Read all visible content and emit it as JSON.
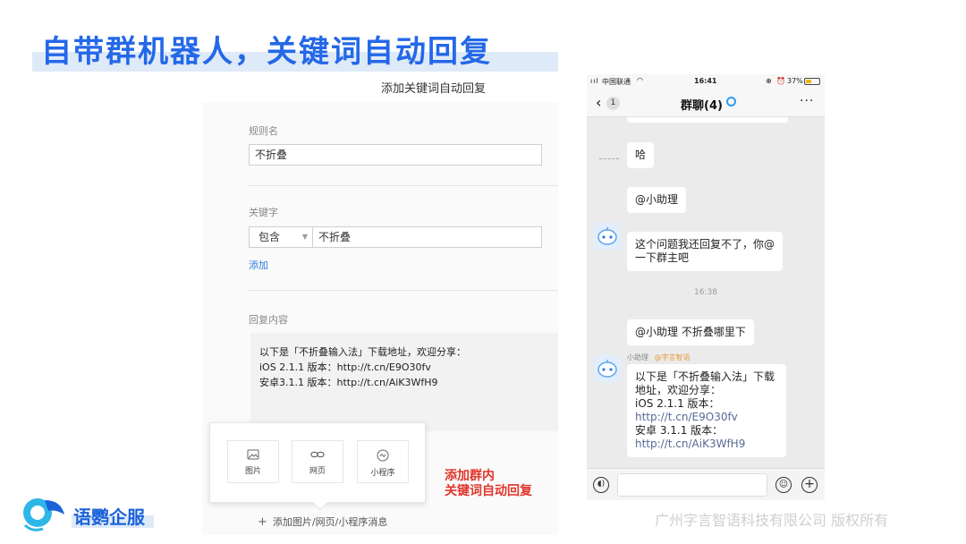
{
  "slide": {
    "title": "自带群机器人，关键词自动回复",
    "annotation_lines": [
      "添加群内",
      "关键词自动回复"
    ],
    "brand": "语鹦企服",
    "copyright": "广州字言智语科技有限公司 版权所有"
  },
  "form": {
    "header": "添加关键词自动回复",
    "rule_name_label": "规则名",
    "rule_name_value": "不折叠",
    "keyword_label": "关键字",
    "match_mode": "包含",
    "keyword_value": "不折叠",
    "add_link": "添加",
    "reply_label": "回复内容",
    "reply_lines": [
      "以下是「不折叠输入法」下载地址，欢迎分享：",
      "iOS 2.1.1 版本：http://t.cn/E9O30fv",
      "安卓3.1.1 版本：http://t.cn/AiK3WfH9"
    ],
    "attach_options": [
      "图片",
      "网页",
      "小程序"
    ],
    "add_media": "添加图片/网页/小程序消息"
  },
  "phone": {
    "carrier": "中国联通",
    "time": "16:41",
    "battery": "37%",
    "back_count": "1",
    "chat_title": "群聊(4)",
    "messages": {
      "m1": "哈",
      "m2": "@小助理",
      "m3": [
        "这个问题我还回复不了，你@",
        "一下群主吧"
      ],
      "timestamp": "16:38",
      "m4": "@小助理 不折叠哪里下",
      "bot_name": "小助理",
      "bot_tag": "@字言智语",
      "m5_text": [
        "以下是「不折叠输入法」下载",
        "地址，欢迎分享：",
        "iOS 2.1.1 版本："
      ],
      "m5_link1": "http://t.cn/E9O30fv",
      "m5_text2": "安卓 3.1.1 版本：",
      "m5_link2": "http://t.cn/AiK3WfH9"
    }
  },
  "colors": {
    "title_blue": "#2468e8",
    "annotation_red": "#e0352b",
    "link_blue": "#576b95"
  }
}
